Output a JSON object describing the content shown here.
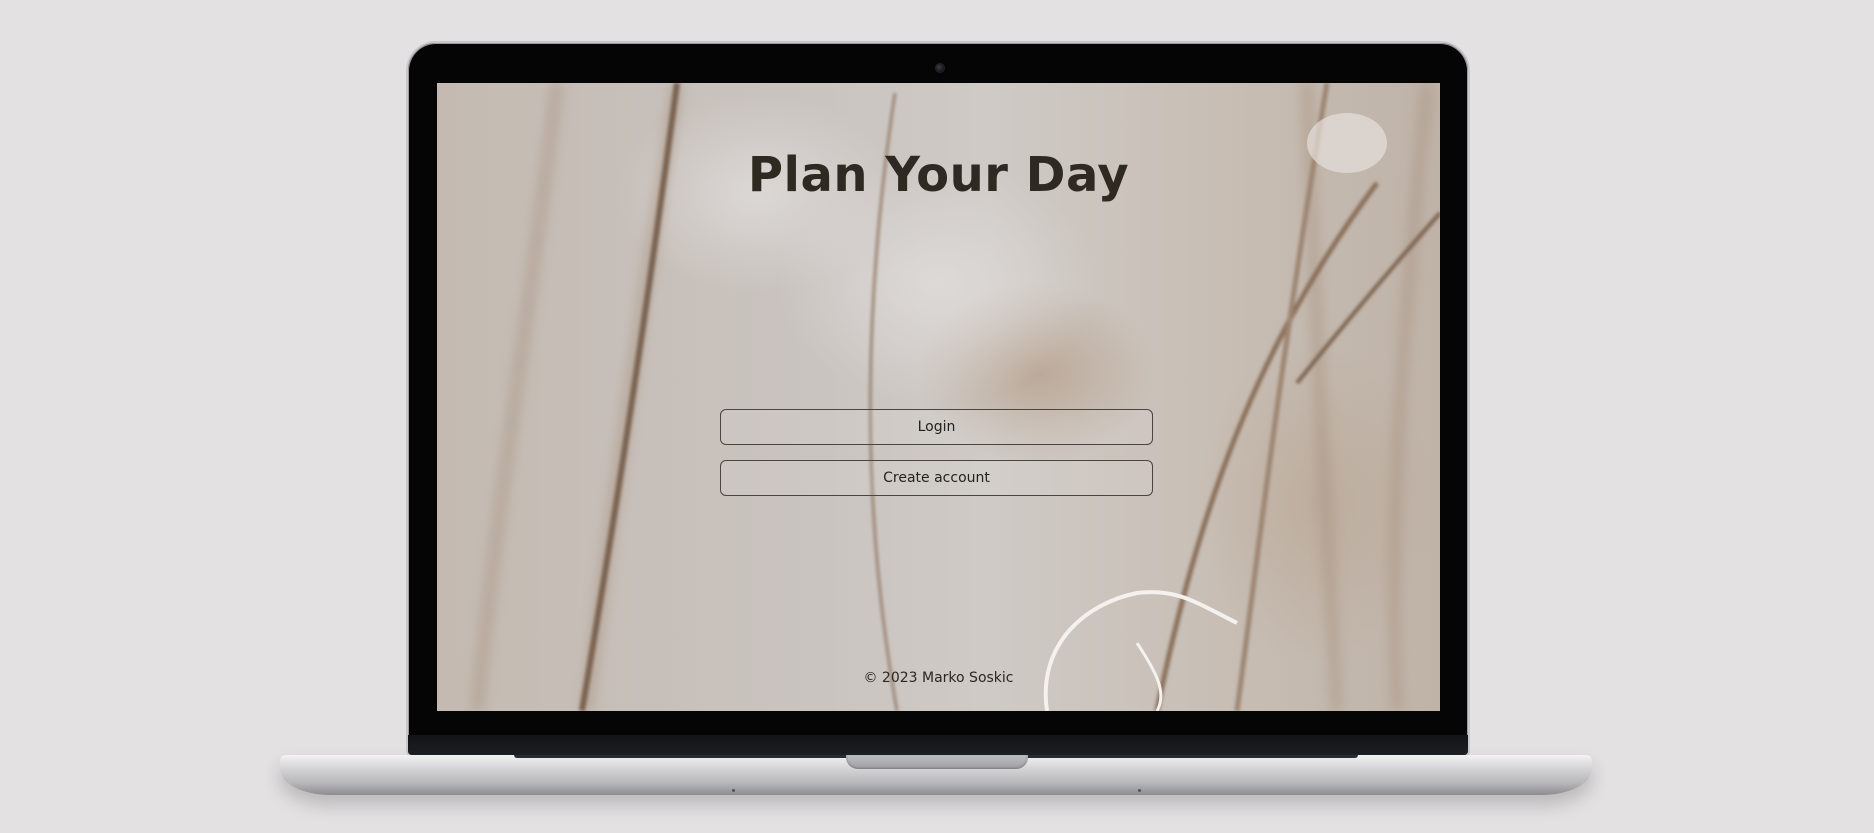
{
  "app": {
    "title": "Plan Your Day"
  },
  "actions": {
    "login_label": "Login",
    "create_account_label": "Create account"
  },
  "footer": {
    "copyright": "© 2023 Marko Soskic"
  },
  "theme": {
    "page_background": "#e3e1e2",
    "title_color": "#2e2a22",
    "button_border": "#4a4540",
    "screen_tint": "#c6bdb5"
  },
  "device": {
    "frame": "laptop-mockup",
    "camera_icon": "camera-icon"
  }
}
